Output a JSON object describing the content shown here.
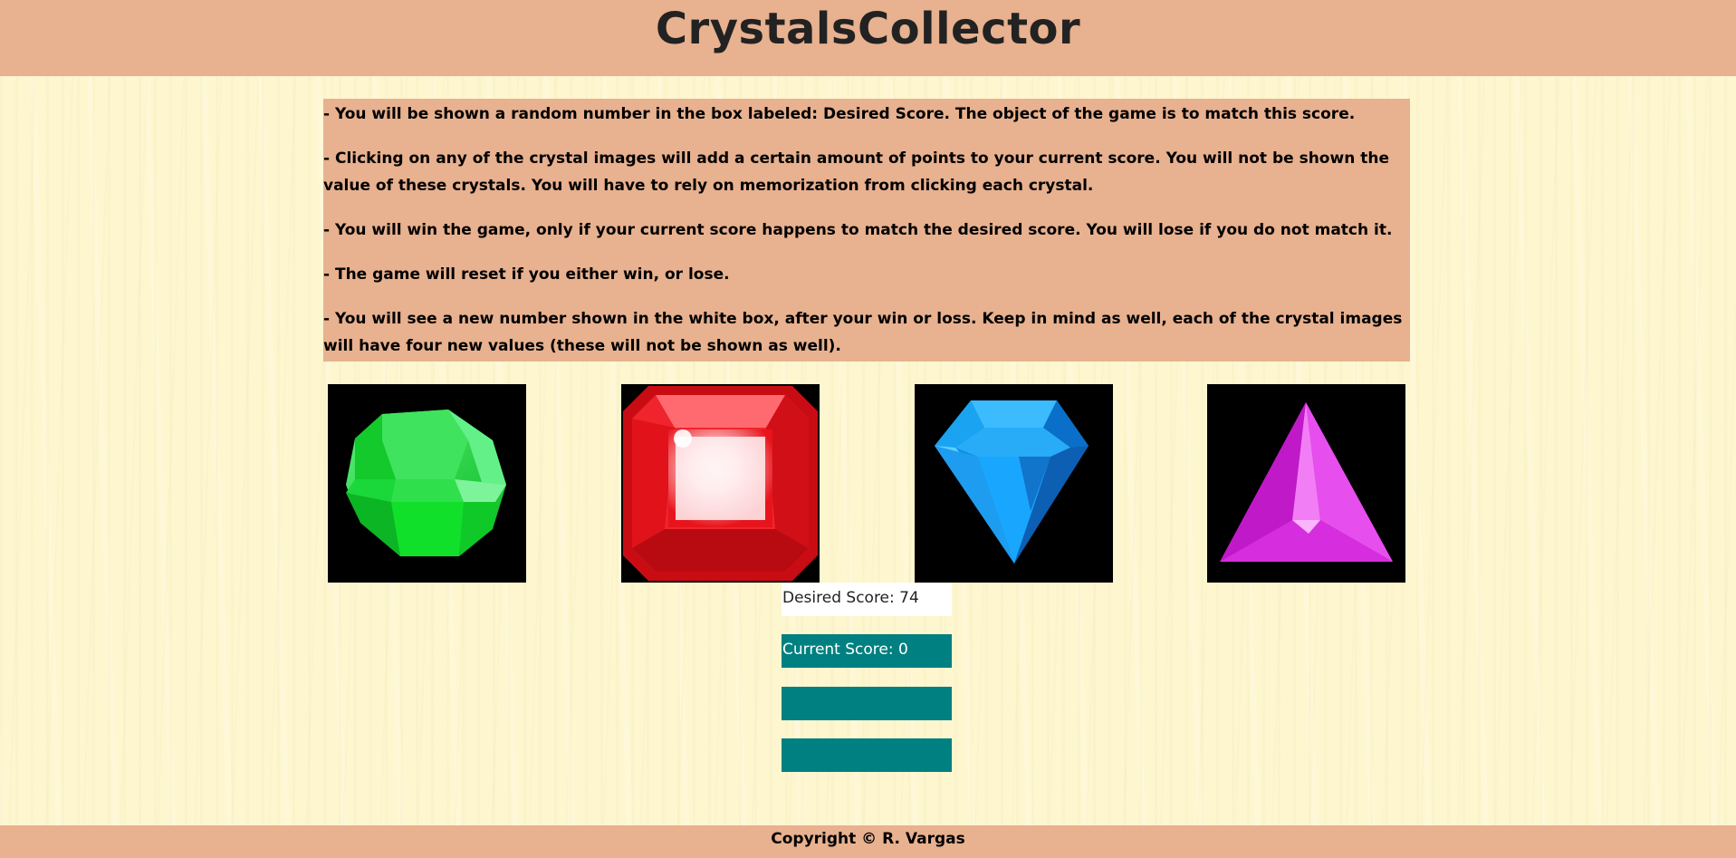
{
  "header": {
    "title": "CrystalsCollector"
  },
  "instructions": [
    "- You will be shown a random number in the box labeled: Desired Score. The object of the game is to match this score.",
    "- Clicking on any of the crystal images will add a certain amount of points to your current score. You will not be shown the value of these crystals. You will have to rely on memorization from clicking each crystal.",
    "- You will win the game, only if your current score happens to match the desired score. You will lose if you do not match it.",
    "- The game will reset if you either win, or lose.",
    "- You will see a new number shown in the white box, after your win or loss. Keep in mind as well, each of the crystal images will have four new values (these will not be shown as well)."
  ],
  "crystals": [
    {
      "name": "green",
      "icon": "green-crystal-icon",
      "color": "#16d82a"
    },
    {
      "name": "red",
      "icon": "red-crystal-icon",
      "color": "#e8141c"
    },
    {
      "name": "blue",
      "icon": "blue-crystal-icon",
      "color": "#1aa3f0"
    },
    {
      "name": "purple",
      "icon": "purple-crystal-icon",
      "color": "#d316d8"
    }
  ],
  "scores": {
    "desired_label": "Desired Score: 74",
    "current_label": "Current Score: 0",
    "wins_label": "",
    "losses_label": ""
  },
  "footer": {
    "copyright": "Copyright © R. Vargas"
  },
  "colors": {
    "header_bg": "#e8b18f",
    "teal": "#008080",
    "page_bg": "#fdf6cf"
  }
}
